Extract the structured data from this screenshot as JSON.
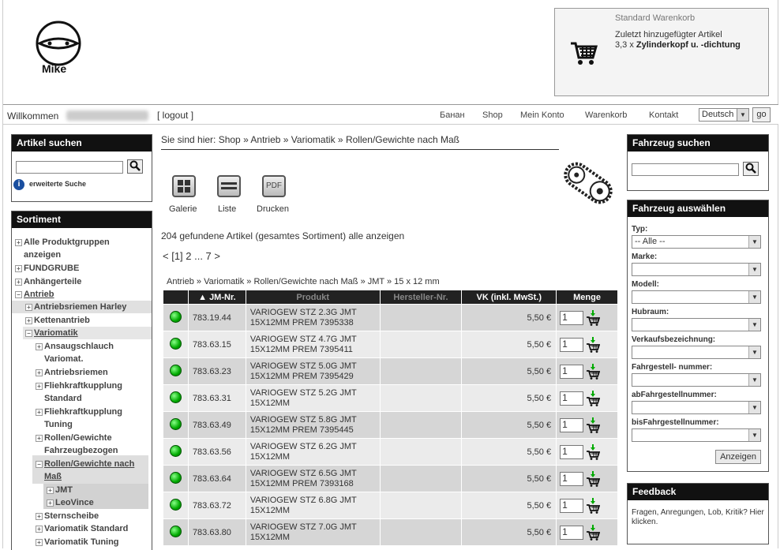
{
  "header": {
    "logo_text": "Mike",
    "cart": {
      "title": "Standard Warenkorb",
      "subtitle": "Zuletzt hinzugefügter Artikel",
      "item_qty": "3,3 x ",
      "item_name": "Zylinderkopf u. -dichtung"
    }
  },
  "topbar": {
    "welcome": "Willkommen",
    "logout": "[ logout ]",
    "nav": [
      "Банан",
      "Shop",
      "Mein Konto",
      "Warenkorb",
      "Kontakt"
    ],
    "language": "Deutsch",
    "go": "go"
  },
  "left": {
    "search_title": "Artikel suchen",
    "extended_search": "erweiterte Suche",
    "assortment_title": "Sortiment",
    "tree": [
      {
        "label": "Alle Produktgruppen",
        "label2": "anzeigen",
        "pm": "+"
      },
      {
        "label": "FUNDGRUBE",
        "pm": "+"
      },
      {
        "label": "Anhängerteile",
        "pm": "+"
      },
      {
        "label": "Antrieb",
        "pm": "−"
      },
      {
        "label": "Antriebsriemen Harley",
        "pm": "+"
      },
      {
        "label": "Kettenantrieb",
        "pm": "+"
      },
      {
        "label": "Variomatik",
        "pm": "−"
      },
      {
        "label": "Ansaugschlauch",
        "label2": "Variomat.",
        "pm": "+"
      },
      {
        "label": "Antriebsriemen",
        "pm": "+"
      },
      {
        "label": "Fliehkraftkupplung",
        "label2": "Standard",
        "pm": "+"
      },
      {
        "label": "Fliehkraftkupplung",
        "label2": "Tuning",
        "pm": "+"
      },
      {
        "label": "Rollen/Gewichte",
        "label2": "Fahrzeugbezogen",
        "pm": "+"
      },
      {
        "label": "Rollen/Gewichte nach",
        "label2": "Maß",
        "pm": "−"
      },
      {
        "label": "JMT",
        "pm": "+"
      },
      {
        "label": "LeoVince",
        "pm": "+"
      },
      {
        "label": "Sternscheibe",
        "pm": "+"
      },
      {
        "label": "Variomatik Standard",
        "pm": "+"
      },
      {
        "label": "Variomatik Tuning",
        "pm": "+"
      }
    ]
  },
  "main": {
    "breadcrumb_prefix": "Sie sind hier: ",
    "breadcrumb": [
      "Shop",
      "Antrieb",
      "Variomatik",
      "Rollen/Gewichte nach Maß"
    ],
    "sep": " » ",
    "views": [
      "Galerie",
      "Liste",
      "Drucken"
    ],
    "count_text": "204 gefundene Artikel (gesamtes Sortiment) alle anzeigen",
    "pager": "< [1] 2 ... 7 >",
    "crumb2": "Antrieb » Variomatik » Rollen/Gewichte nach Maß » JMT » 15 x 12 mm",
    "table": {
      "headers": [
        "▲ JM-Nr.",
        "Produkt",
        "Hersteller-Nr.",
        "VK (inkl. MwSt.)",
        "Menge"
      ],
      "rows": [
        {
          "nr": "783.19.44",
          "p1": "VARIOGEW STZ 2.3G JMT",
          "p2": "15X12MM PREM 7395338",
          "vk": "5,50 €",
          "qty": "1"
        },
        {
          "nr": "783.63.15",
          "p1": "VARIOGEW STZ 4.7G JMT",
          "p2": "15X12MM PREM 7395411",
          "vk": "5,50 €",
          "qty": "1"
        },
        {
          "nr": "783.63.23",
          "p1": "VARIOGEW STZ 5.0G JMT",
          "p2": "15X12MM PREM 7395429",
          "vk": "5,50 €",
          "qty": "1"
        },
        {
          "nr": "783.63.31",
          "p1": "VARIOGEW STZ 5.2G JMT",
          "p2": "15X12MM",
          "vk": "5,50 €",
          "qty": "1"
        },
        {
          "nr": "783.63.49",
          "p1": "VARIOGEW STZ 5.8G JMT",
          "p2": "15X12MM PREM 7395445",
          "vk": "5,50 €",
          "qty": "1"
        },
        {
          "nr": "783.63.56",
          "p1": "VARIOGEW STZ 6.2G JMT",
          "p2": "15X12MM",
          "vk": "5,50 €",
          "qty": "1"
        },
        {
          "nr": "783.63.64",
          "p1": "VARIOGEW STZ 6.5G JMT",
          "p2": "15X12MM PREM 7393168",
          "vk": "5,50 €",
          "qty": "1"
        },
        {
          "nr": "783.63.72",
          "p1": "VARIOGEW STZ 6.8G JMT",
          "p2": "15X12MM",
          "vk": "5,50 €",
          "qty": "1"
        },
        {
          "nr": "783.63.80",
          "p1": "VARIOGEW STZ 7.0G JMT",
          "p2": "15X12MM",
          "vk": "5,50 €",
          "qty": "1"
        }
      ]
    }
  },
  "right": {
    "vehicle_search_title": "Fahrzeug suchen",
    "vehicle_select_title": "Fahrzeug auswählen",
    "fields": [
      {
        "label": "Typ:",
        "value": "-- Alle --"
      },
      {
        "label": "Marke:",
        "value": ""
      },
      {
        "label": "Modell:",
        "value": ""
      },
      {
        "label": "Hubraum:",
        "value": ""
      },
      {
        "label": "Verkaufsbezeichnung:",
        "value": ""
      },
      {
        "label": "Fahrgestell- nummer:",
        "value": ""
      },
      {
        "label": "abFahrgestellnummer:",
        "value": ""
      },
      {
        "label": "bisFahrgestellnummer:",
        "value": ""
      }
    ],
    "show_button": "Anzeigen",
    "feedback_title": "Feedback",
    "feedback_text": "Fragen, Anregungen, Lob, Kritik? Hier klicken."
  }
}
